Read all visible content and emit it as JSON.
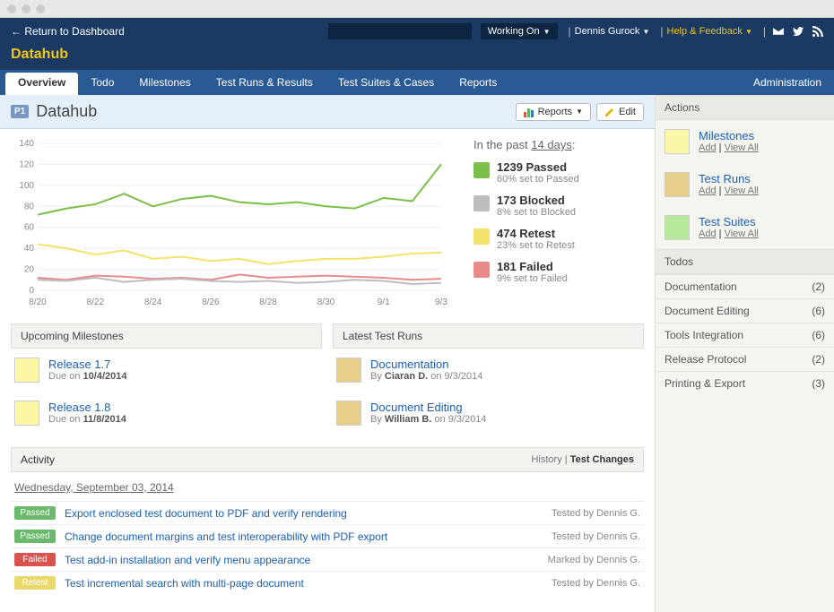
{
  "macbar": true,
  "topbar": {
    "return": "Return to Dashboard",
    "working_on": "Working On",
    "user": "Dennis Gurock",
    "help": "Help & Feedback"
  },
  "site_title": "Datahub",
  "nav": {
    "tabs": [
      "Overview",
      "Todo",
      "Milestones",
      "Test Runs & Results",
      "Test Suites & Cases",
      "Reports"
    ],
    "active": 0,
    "admin": "Administration"
  },
  "page": {
    "badge": "P1",
    "title": "Datahub",
    "reports_btn": "Reports",
    "edit_btn": "Edit"
  },
  "chart_data": {
    "type": "line",
    "x": [
      "8/20",
      "8/21",
      "8/22",
      "8/23",
      "8/24",
      "8/25",
      "8/26",
      "8/27",
      "8/28",
      "8/29",
      "8/30",
      "8/31",
      "9/1",
      "9/2",
      "9/3"
    ],
    "x_ticks": [
      "8/20",
      "8/22",
      "8/24",
      "8/26",
      "8/28",
      "8/30",
      "9/1",
      "9/3"
    ],
    "ylim": [
      0,
      140
    ],
    "y_ticks": [
      0,
      20,
      40,
      60,
      80,
      100,
      120,
      140
    ],
    "series": [
      {
        "name": "Passed",
        "color": "#7cc04a",
        "values": [
          72,
          78,
          82,
          92,
          80,
          87,
          90,
          84,
          82,
          84,
          80,
          78,
          88,
          85,
          120
        ]
      },
      {
        "name": "Retest",
        "color": "#f3e36b",
        "values": [
          44,
          40,
          34,
          38,
          30,
          32,
          28,
          30,
          25,
          28,
          30,
          30,
          32,
          35,
          36
        ]
      },
      {
        "name": "Failed",
        "color": "#e98b8b",
        "values": [
          12,
          10,
          14,
          13,
          11,
          12,
          10,
          15,
          12,
          13,
          14,
          13,
          12,
          10,
          11
        ]
      },
      {
        "name": "Blocked",
        "color": "#bdbdbd",
        "values": [
          10,
          9,
          12,
          8,
          10,
          11,
          9,
          8,
          9,
          7,
          8,
          10,
          9,
          6,
          7
        ]
      }
    ]
  },
  "legend": {
    "title_prefix": "In the past ",
    "title_link": "14 days",
    "title_suffix": ":",
    "items": [
      {
        "color": "#7cc04a",
        "count": "1239 Passed",
        "sub": "60% set to Passed"
      },
      {
        "color": "#bdbdbd",
        "count": "173 Blocked",
        "sub": "8% set to Blocked"
      },
      {
        "color": "#f3e36b",
        "count": "474 Retest",
        "sub": "23% set to Retest"
      },
      {
        "color": "#e98b8b",
        "count": "181 Failed",
        "sub": "9% set to Failed"
      }
    ]
  },
  "upcoming": {
    "header": "Upcoming Milestones",
    "items": [
      {
        "color": "#faf7a7",
        "title": "Release 1.7",
        "sub_prefix": "Due on ",
        "sub_bold": "10/4/2014"
      },
      {
        "color": "#faf7a7",
        "title": "Release 1.8",
        "sub_prefix": "Due on ",
        "sub_bold": "11/8/2014"
      }
    ]
  },
  "latest_runs": {
    "header": "Latest Test Runs",
    "items": [
      {
        "color": "#e6cf8a",
        "title": "Documentation",
        "sub_prefix": "By ",
        "sub_bold": "Ciaran D.",
        "sub_suffix": " on 9/3/2014"
      },
      {
        "color": "#e6cf8a",
        "title": "Document Editing",
        "sub_prefix": "By ",
        "sub_bold": "William B.",
        "sub_suffix": " on 9/3/2014"
      }
    ]
  },
  "activity": {
    "header": "Activity",
    "link_history": "History",
    "link_changes": "Test Changes",
    "date": "Wednesday, September 03, 2014",
    "rows": [
      {
        "status": "Passed",
        "color": "#6bb96b",
        "text": "Export enclosed test document to PDF and verify rendering",
        "by": "Tested by Dennis G."
      },
      {
        "status": "Passed",
        "color": "#6bb96b",
        "text": "Change document margins and test interoperability with PDF export",
        "by": "Tested by Dennis G."
      },
      {
        "status": "Failed",
        "color": "#d9534f",
        "text": "Test add-in installation and verify menu appearance",
        "by": "Marked by Dennis G."
      },
      {
        "status": "Retest",
        "color": "#e9d96b",
        "text": "Test incremental search with multi-page document",
        "by": "Tested by Dennis G."
      }
    ]
  },
  "sidebar": {
    "actions_header": "Actions",
    "actions": [
      {
        "color": "#faf7a7",
        "title": "Milestones",
        "add": "Add",
        "view": "View All"
      },
      {
        "color": "#e6cf8a",
        "title": "Test Runs",
        "add": "Add",
        "view": "View All"
      },
      {
        "color": "#b6e99a",
        "title": "Test Suites",
        "add": "Add",
        "view": "View All"
      }
    ],
    "todos_header": "Todos",
    "todos": [
      {
        "label": "Documentation",
        "count": "(2)"
      },
      {
        "label": "Document Editing",
        "count": "(6)"
      },
      {
        "label": "Tools Integration",
        "count": "(6)"
      },
      {
        "label": "Release Protocol",
        "count": "(2)"
      },
      {
        "label": "Printing & Export",
        "count": "(3)"
      }
    ]
  }
}
